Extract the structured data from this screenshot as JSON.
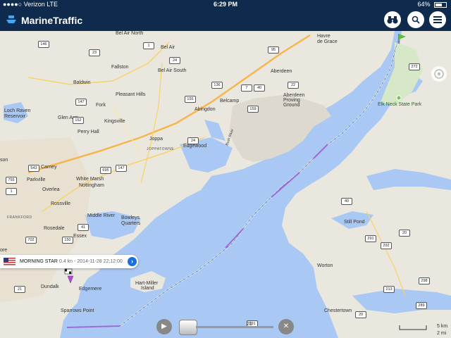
{
  "status_bar": {
    "carrier": "●●●●○ Verizon  LTE",
    "time": "6:29 PM",
    "battery": "64%",
    "battery_level": 0.64
  },
  "header": {
    "title": "MarineTraffic",
    "binoculars_icon": "binoculars-icon",
    "search_icon": "search-icon",
    "menu_icon": "menu-icon"
  },
  "popup": {
    "vessel": "MORNING STAR",
    "distance": "0.4 kn",
    "time": "2014-11-28 22:12:00",
    "flag": "us-flag-icon"
  },
  "playback": {
    "play_icon": "play-icon",
    "close_icon": "close-icon",
    "value": "21"
  },
  "scale": {
    "km": "5 km",
    "mi": "2 mi"
  },
  "places": {
    "havre": "Havre",
    "degrace": "de Grace",
    "belair_north": "Bel Air North",
    "belair": "Bel Air",
    "belair_south": "Bel Air South",
    "fallston": "Fallston",
    "baldwin": "Baldwin",
    "aberdeen": "Aberdeen",
    "pleasant_hills": "Pleasant Hills",
    "fork": "Fork",
    "kingsville": "Kingsville",
    "glen_arm": "Glen Arm",
    "loch": "Loch Raven",
    "reservoir": "Reservoir",
    "abingdon": "Abingdon",
    "belcamp": "Belcamp",
    "apg1": "Aberdeen",
    "apg2": "Proving",
    "apg3": "Ground",
    "joppa": "Joppa",
    "joppatowne": "JOPPATOWNE",
    "edgewood": "Edgewood",
    "perry_hall": "Perry Hall",
    "carney": "Carney",
    "parkville": "Parkville",
    "white_marsh": "White Marsh",
    "nottingham": "Nottingham",
    "overlea": "Overlea",
    "rossville": "Rossville",
    "frankford": "FRANKFORD",
    "rosedale": "Rosedale",
    "middle_river": "Middle River",
    "bowleys1": "Bowleys",
    "bowleys2": "Quarters",
    "essex": "Essex",
    "ore": "ore",
    "dundalk": "Dundalk",
    "edgemere": "Edgemere",
    "sparrows": "Sparrows Point",
    "hart1": "Hart-Miller",
    "hart2": "Island",
    "elk_neck": "Elk Neck State Park",
    "still_pond": "Still Pond",
    "worton": "Worton",
    "chestertown": "Chestertown",
    "son": "son",
    "bush_river": "Bush River"
  },
  "roads": [
    "146",
    "23",
    "1",
    "24",
    "95",
    "40",
    "136",
    "22",
    "7",
    "155",
    "159",
    "272",
    "147",
    "152",
    "1",
    "147",
    "40",
    "7",
    "24",
    "755",
    "543",
    "695",
    "95",
    "1",
    "542",
    "41",
    "702",
    "150",
    "702",
    "40",
    "20",
    "292",
    "298",
    "213",
    "291",
    "297",
    "20",
    "289",
    "291",
    "21",
    "695",
    "157",
    "151",
    "297",
    "298"
  ],
  "colors": {
    "water": "#a9c8f3",
    "land": "#eae7df",
    "header": "#0e2a4c",
    "track_blue": "#ffffff",
    "track_purple": "#9b6ad6",
    "accent": "#1c6fd8"
  }
}
